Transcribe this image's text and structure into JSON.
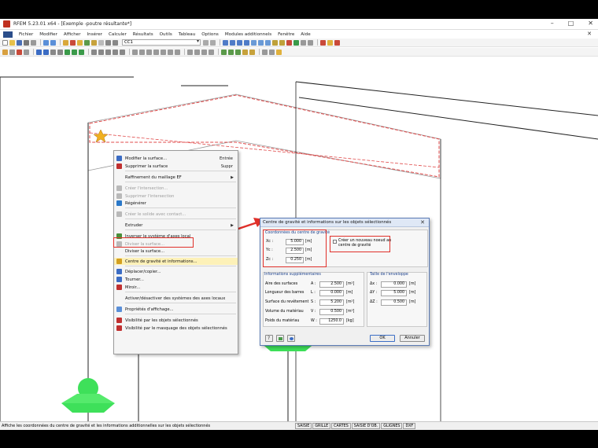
{
  "window": {
    "title": "RFEM 5.23.01 x64 - [Exemple -poutre résultante*]",
    "controls": [
      "–",
      "□",
      "✕"
    ],
    "mdi_close": "✕"
  },
  "menu": {
    "items": [
      "Fichier",
      "Modifier",
      "Afficher",
      "Insérer",
      "Calculer",
      "Résultats",
      "Outils",
      "Tableau",
      "Options",
      "Modules additionnels",
      "Fenêtre",
      "Aide"
    ]
  },
  "toolbar": {
    "loadcase": "CC1"
  },
  "context_menu": {
    "items": [
      {
        "label": "Modifier la surface...",
        "shortcut": "Entrée",
        "disabled": false,
        "icon_color": "#3b6cc4"
      },
      {
        "label": "Supprimer la surface",
        "shortcut": "Suppr",
        "disabled": false,
        "icon_color": "#c03030"
      },
      {
        "label": "Raffinement du maillage EF",
        "shortcut": "",
        "submenu": true,
        "disabled": false,
        "icon_color": ""
      },
      {
        "label": "Créer l'intersection...",
        "shortcut": "",
        "disabled": true,
        "icon_color": "#b9b9b9"
      },
      {
        "label": "Supprimer l'intersection",
        "shortcut": "",
        "disabled": true,
        "icon_color": "#b9b9b9"
      },
      {
        "label": "Régénérer",
        "shortcut": "",
        "disabled": false,
        "icon_color": "#2a78c8"
      },
      {
        "label": "Créer le solide avec contact...",
        "shortcut": "",
        "disabled": true,
        "icon_color": "#b9b9b9"
      },
      {
        "label": "Extruder",
        "shortcut": "",
        "submenu": true,
        "disabled": false,
        "icon_color": ""
      },
      {
        "label": "Inverser le système d'axes local",
        "shortcut": "",
        "disabled": false,
        "icon_color": "#4a8f3a"
      },
      {
        "label": "Diviser la surface...",
        "shortcut": "",
        "disabled": true,
        "icon_color": "#b9b9b9"
      },
      {
        "label": "Diviser la surface...",
        "shortcut": "",
        "disabled": false,
        "icon_color": ""
      },
      {
        "label": "Centre de gravité et informations...",
        "shortcut": "",
        "disabled": false,
        "icon_color": "#d4a020"
      },
      {
        "label": "Déplacer/copier...",
        "shortcut": "",
        "disabled": false,
        "icon_color": "#3b6cc4"
      },
      {
        "label": "Tourner...",
        "shortcut": "",
        "disabled": false,
        "icon_color": "#3b6cc4"
      },
      {
        "label": "Miroir...",
        "shortcut": "",
        "disabled": false,
        "icon_color": "#c03030"
      },
      {
        "label": "Activer/désactiver des systèmes des axes locaux",
        "shortcut": "",
        "disabled": false,
        "icon_color": ""
      },
      {
        "label": "Propriétés d'affichage...",
        "shortcut": "",
        "disabled": false,
        "icon_color": "#5a8fd8"
      },
      {
        "label": "Visibilité par les objets sélectionnés",
        "shortcut": "",
        "disabled": false,
        "icon_color": "#c03030"
      },
      {
        "label": "Visibilité par le masquage des objets sélectionnés",
        "shortcut": "",
        "disabled": false,
        "icon_color": "#c03030"
      }
    ]
  },
  "dialog": {
    "title": "Centre de gravité et informations sur les objets sélectionnés",
    "close": "✕",
    "cog": {
      "header": "Coordonnées du centre de gravité",
      "rows": [
        {
          "label": "Xc :",
          "value": "5.000",
          "unit": "[m]"
        },
        {
          "label": "Yc :",
          "value": "2.500",
          "unit": "[m]"
        },
        {
          "label": "Zc :",
          "value": "0.250",
          "unit": "[m]"
        }
      ]
    },
    "create_node": {
      "label_line1": "Créer un nouveau noeud au",
      "label_line2": "centre de gravité",
      "checked": false
    },
    "info": {
      "header": "Informations supplémentaires",
      "rows": [
        {
          "label": "Aire des surfaces",
          "symbol": "A :",
          "value": "2.500",
          "unit": "[m²]"
        },
        {
          "label": "Longueur des barres",
          "symbol": "L :",
          "value": "0.000",
          "unit": "[m]"
        },
        {
          "label": "Surface du revêtement",
          "symbol": "S :",
          "value": "5.200",
          "unit": "[m²]"
        },
        {
          "label": "Volume du matériau",
          "symbol": "V :",
          "value": "0.500",
          "unit": "[m³]"
        },
        {
          "label": "Poids du matériau",
          "symbol": "W :",
          "value": "1250.0",
          "unit": "[kg]"
        }
      ]
    },
    "envelope": {
      "header": "Taille de l'enveloppe",
      "rows": [
        {
          "label": "Δx :",
          "value": "0.000",
          "unit": "[m]"
        },
        {
          "label": "ΔY :",
          "value": "5.000",
          "unit": "[m]"
        },
        {
          "label": "ΔZ :",
          "value": "0.500",
          "unit": "[m]"
        }
      ]
    },
    "ok": "OK",
    "cancel": "Annuler"
  },
  "statusbar": {
    "message": "Affiche les coordonnées du centre de gravité et les informations additionnelles sur les objets sélectionnés",
    "tabs": [
      "SAISIE",
      "GRILLE",
      "CARTES",
      "SAISIE D'OB.",
      "GLIGNES",
      "DXF"
    ]
  },
  "colors": {
    "highlight_red": "#e0302a",
    "support_green": "#3ee05a",
    "dialog_border": "#5b7bb5"
  }
}
